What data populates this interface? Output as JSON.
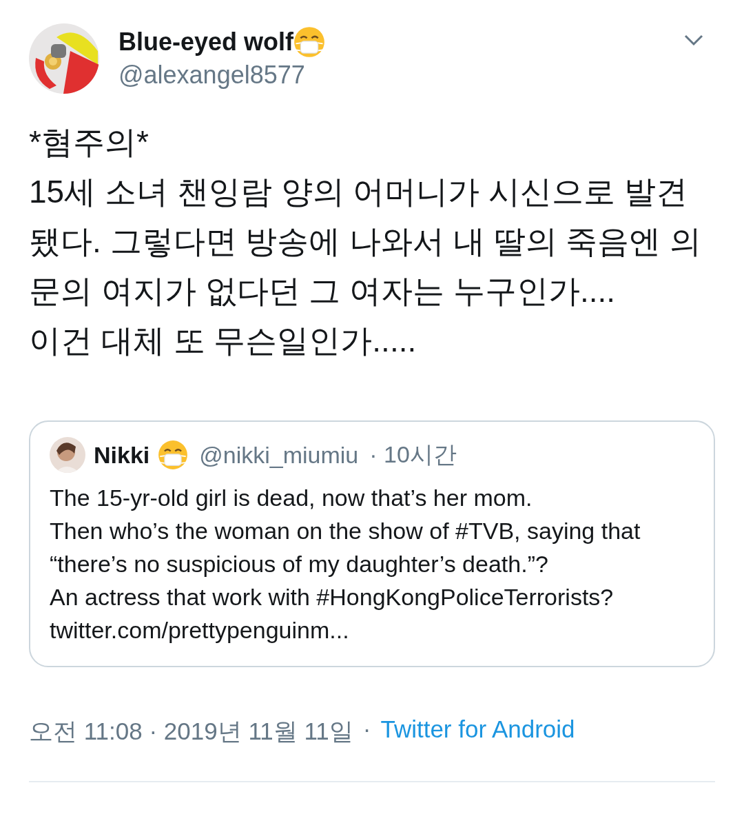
{
  "tweet": {
    "author": {
      "name": "Blue-eyed wolf",
      "handle": "@alexangel8577"
    },
    "text_lines": [
      "*혐주의*",
      "15세 소녀 챈잉람 양의 어머니가 시신으로 발견됐다. 그렇다면 방송에 나와서 내 딸의 죽음엔 의문의 여지가 없다던 그 여자는 누구인가....",
      "이건 대체 또 무슨일인가....."
    ],
    "quoted": {
      "name": "Nikki",
      "handle": "@nikki_miumiu",
      "time": "· 10시간",
      "text_lines": [
        "The 15-yr-old girl is dead, now that’s her mom.",
        "Then who’s the woman on the show of #TVB, saying that",
        "“there’s no suspicious of my daughter’s death.”?",
        "An actress that work with #HongKongPoliceTerrorists?"
      ],
      "link": "twitter.com/prettypenguinm..."
    },
    "timestamp": "오전 11:08 · 2019년 11월 11일",
    "separator": "·",
    "source": "Twitter for Android"
  }
}
